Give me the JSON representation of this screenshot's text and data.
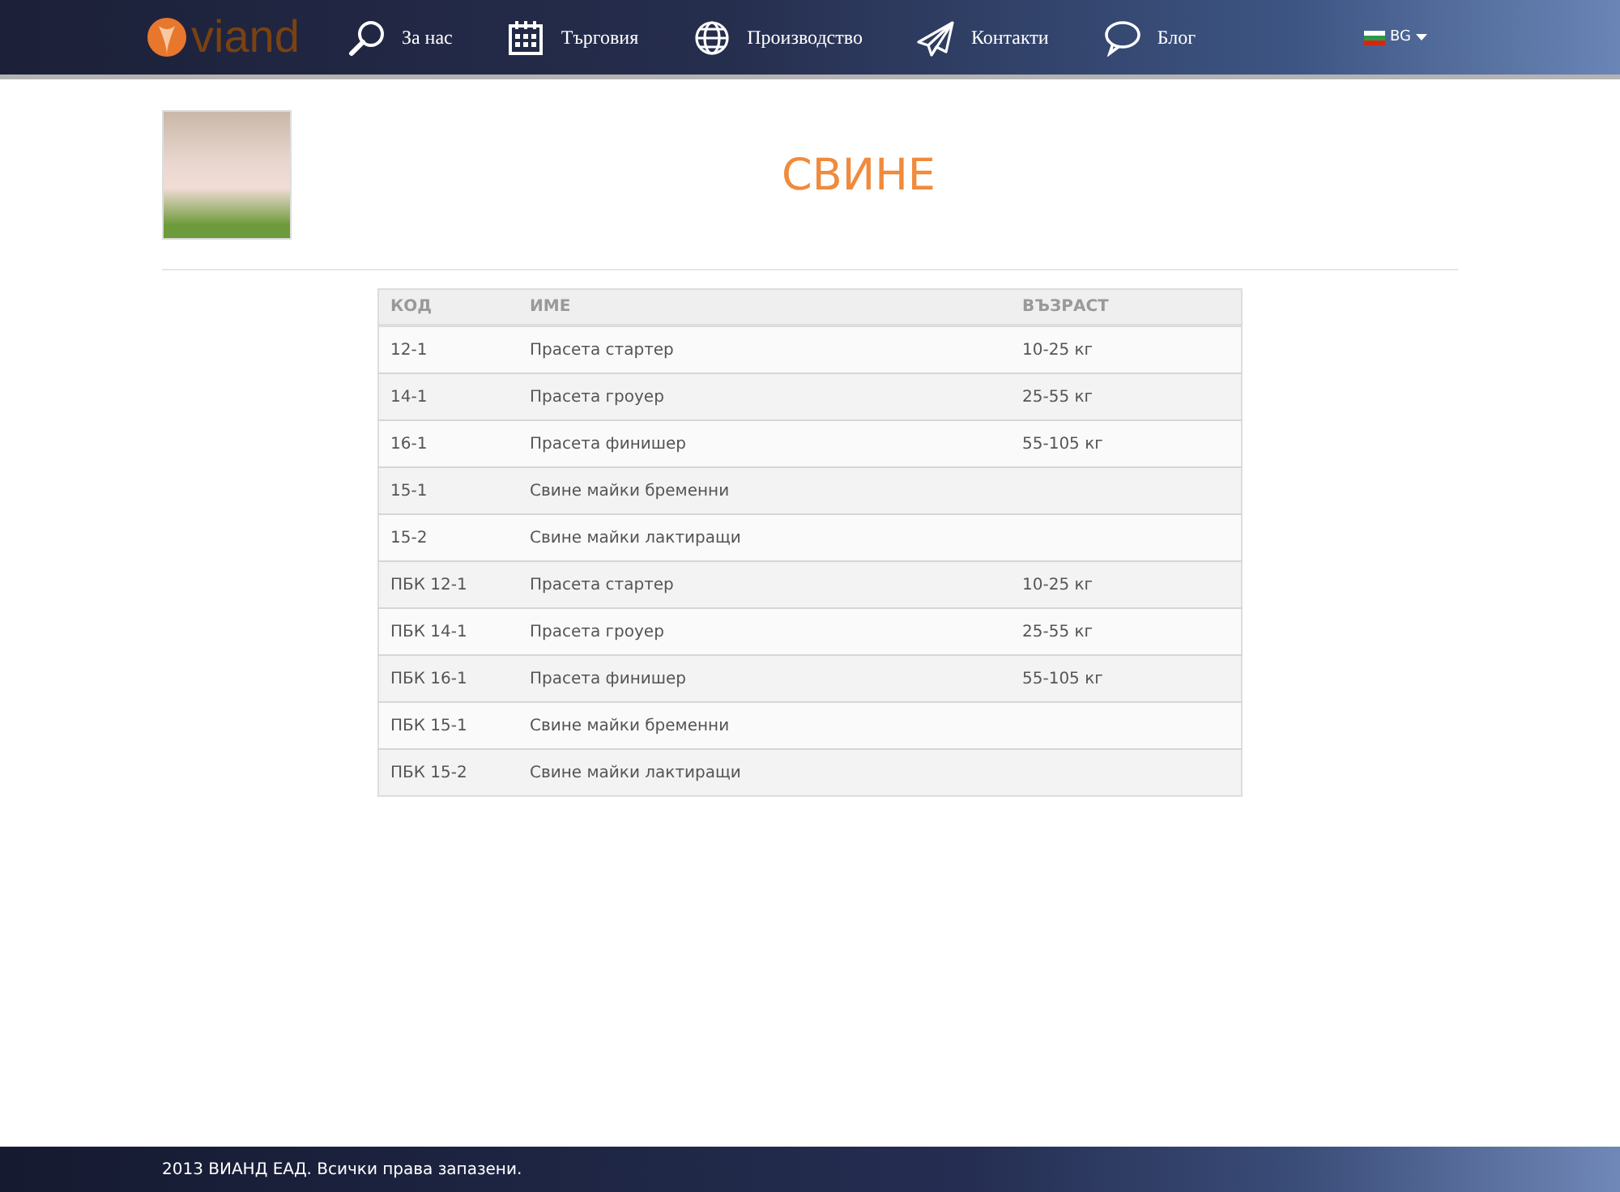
{
  "header": {
    "logo_text": "viand",
    "nav": [
      {
        "label": "За нас"
      },
      {
        "label": "Търговия"
      },
      {
        "label": "Производство"
      },
      {
        "label": "Контакти"
      },
      {
        "label": "Блог"
      }
    ],
    "language": "BG"
  },
  "title": "СВИНЕ",
  "table": {
    "columns": [
      "КОД",
      "ИМЕ",
      "ВЪЗРАСТ"
    ],
    "rows": [
      [
        "12-1",
        "Прасета стартер",
        "10-25 кг"
      ],
      [
        "14-1",
        "Прасета гроуер",
        "25-55 кг"
      ],
      [
        "16-1",
        "Прасета финишер",
        "55-105 кг"
      ],
      [
        "15-1",
        "Свине майки бременни",
        ""
      ],
      [
        "15-2",
        "Свине майки лактиращи",
        ""
      ],
      [
        "ПБК 12-1",
        "Прасета стартер",
        "10-25 кг"
      ],
      [
        "ПБК 14-1",
        "Прасета гроуер",
        "25-55 кг"
      ],
      [
        "ПБК 16-1",
        "Прасета финишер",
        "55-105 кг"
      ],
      [
        "ПБК 15-1",
        "Свине майки бременни",
        ""
      ],
      [
        "ПБК 15-2",
        "Свине майки лактиращи",
        ""
      ]
    ]
  },
  "footer": "2013 ВИАНД ЕАД. Всички права запазени."
}
